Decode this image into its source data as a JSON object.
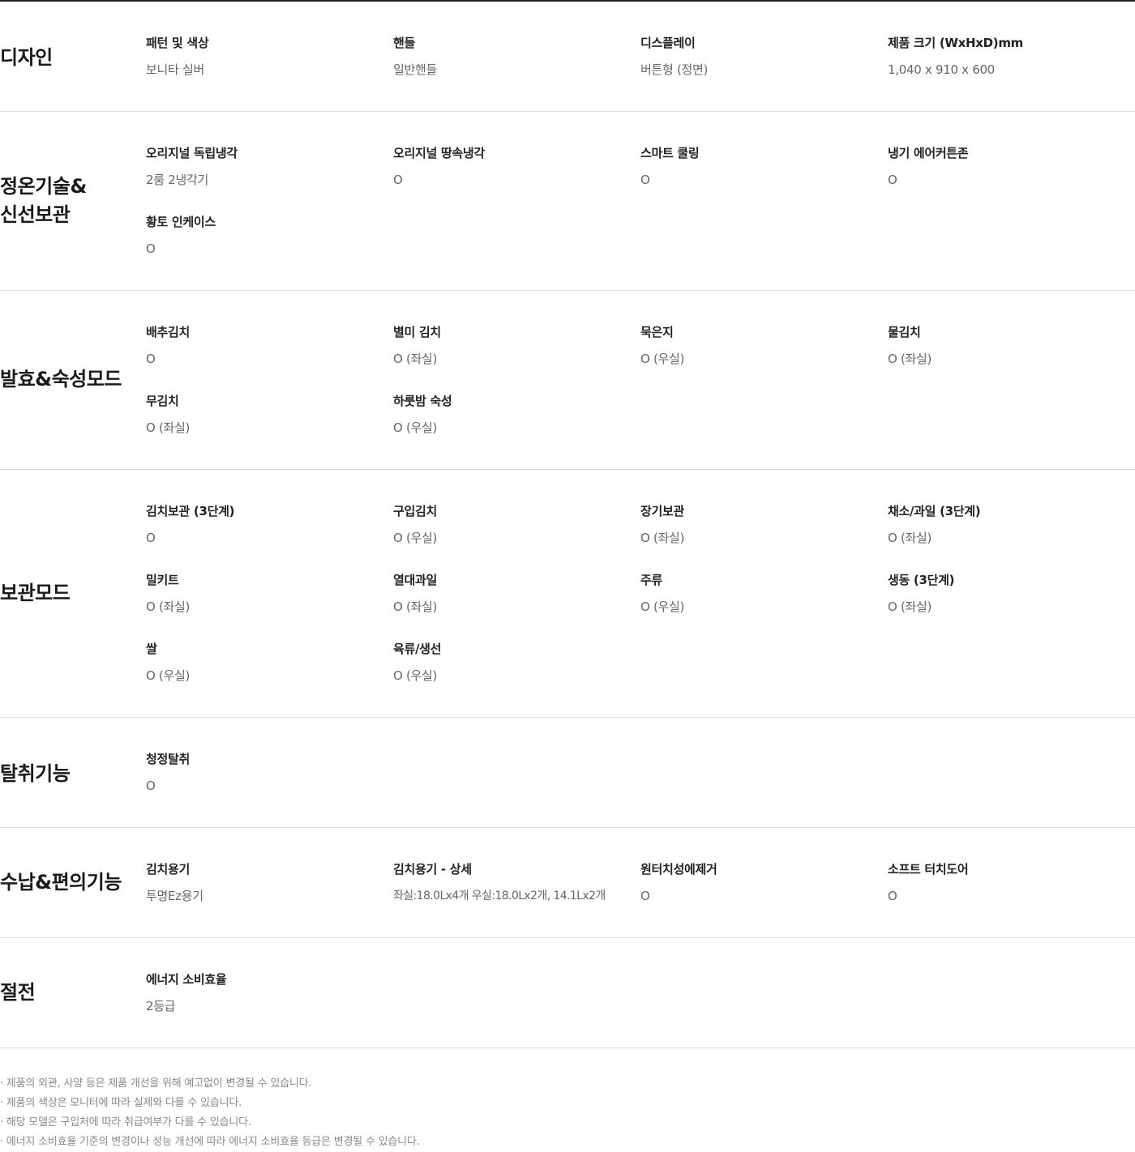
{
  "sections": [
    {
      "title": "디자인",
      "specs": [
        {
          "label": "패턴 및 색상",
          "value": "보니타 실버"
        },
        {
          "label": "핸들",
          "value": "일반핸들"
        },
        {
          "label": "디스플레이",
          "value": "버튼형 (정면)"
        },
        {
          "label": "제품 크기 (WxHxD)mm",
          "value": "1,040 x 910 x 600"
        }
      ]
    },
    {
      "title_line1": "정온기술&",
      "title_line2": "신선보관",
      "specs": [
        {
          "label": "오리지널 독립냉각",
          "value": "2룸 2냉각기"
        },
        {
          "label": "오리지널 땅속냉각",
          "value": "O"
        },
        {
          "label": "스마트 쿨링",
          "value": "O"
        },
        {
          "label": "냉기 에어커튼존",
          "value": "O"
        },
        {
          "label": "황토 인케이스",
          "value": "O"
        }
      ]
    },
    {
      "title": "발효&숙성모드",
      "specs": [
        {
          "label": "배추김치",
          "value": "O"
        },
        {
          "label": "별미 김치",
          "value": "O (좌실)"
        },
        {
          "label": "묵은지",
          "value": "O (우실)"
        },
        {
          "label": "물김치",
          "value": "O (좌실)"
        },
        {
          "label": "무김치",
          "value": "O (좌실)"
        },
        {
          "label": "하룻밤 숙성",
          "value": "O (우실)"
        }
      ]
    },
    {
      "title": "보관모드",
      "specs": [
        {
          "label": "김치보관 (3단계)",
          "value": "O"
        },
        {
          "label": "구입김치",
          "value": "O (우실)"
        },
        {
          "label": "장기보관",
          "value": "O (좌실)"
        },
        {
          "label": "채소/과일 (3단계)",
          "value": "O (좌실)"
        },
        {
          "label": "밀키트",
          "value": "O (좌실)"
        },
        {
          "label": "열대과일",
          "value": "O (좌실)"
        },
        {
          "label": "주류",
          "value": "O (우실)"
        },
        {
          "label": "생동 (3단계)",
          "value": "O (좌실)"
        },
        {
          "label": "쌀",
          "value": "O (우실)"
        },
        {
          "label": "육류/생선",
          "value": "O (우실)"
        }
      ]
    },
    {
      "title": "탈취기능",
      "specs": [
        {
          "label": "청정탈취",
          "value": "O"
        }
      ]
    },
    {
      "title": "수납&편의기능",
      "specs": [
        {
          "label": "김치용기",
          "value": "투명Ez용기"
        },
        {
          "label": "김치용기 - 상세",
          "value": "좌실:18.0Lx4개 우실:18.0Lx2개, 14.1Lx2개"
        },
        {
          "label": "원터치성에제거",
          "value": "O"
        },
        {
          "label": "소프트 터치도어",
          "value": "O"
        }
      ]
    },
    {
      "title": "절전",
      "specs": [
        {
          "label": "에너지 소비효율",
          "value": "2등급"
        }
      ]
    }
  ],
  "notes": [
    "· 제품의 외관, 사양 등은 제품 개선을 위해 예고없이 변경될 수 있습니다.",
    "· 제품의 색상은 모니터에 따라 실제와 다를 수 있습니다.",
    "· 해당 모델은 구입처에 따라 취급여부가 다를 수 있습니다.",
    "· 에너지 소비효율 기준의 변경이나 성능 개선에 따라 에너지 소비효율 등급은 변경될 수 있습니다."
  ]
}
